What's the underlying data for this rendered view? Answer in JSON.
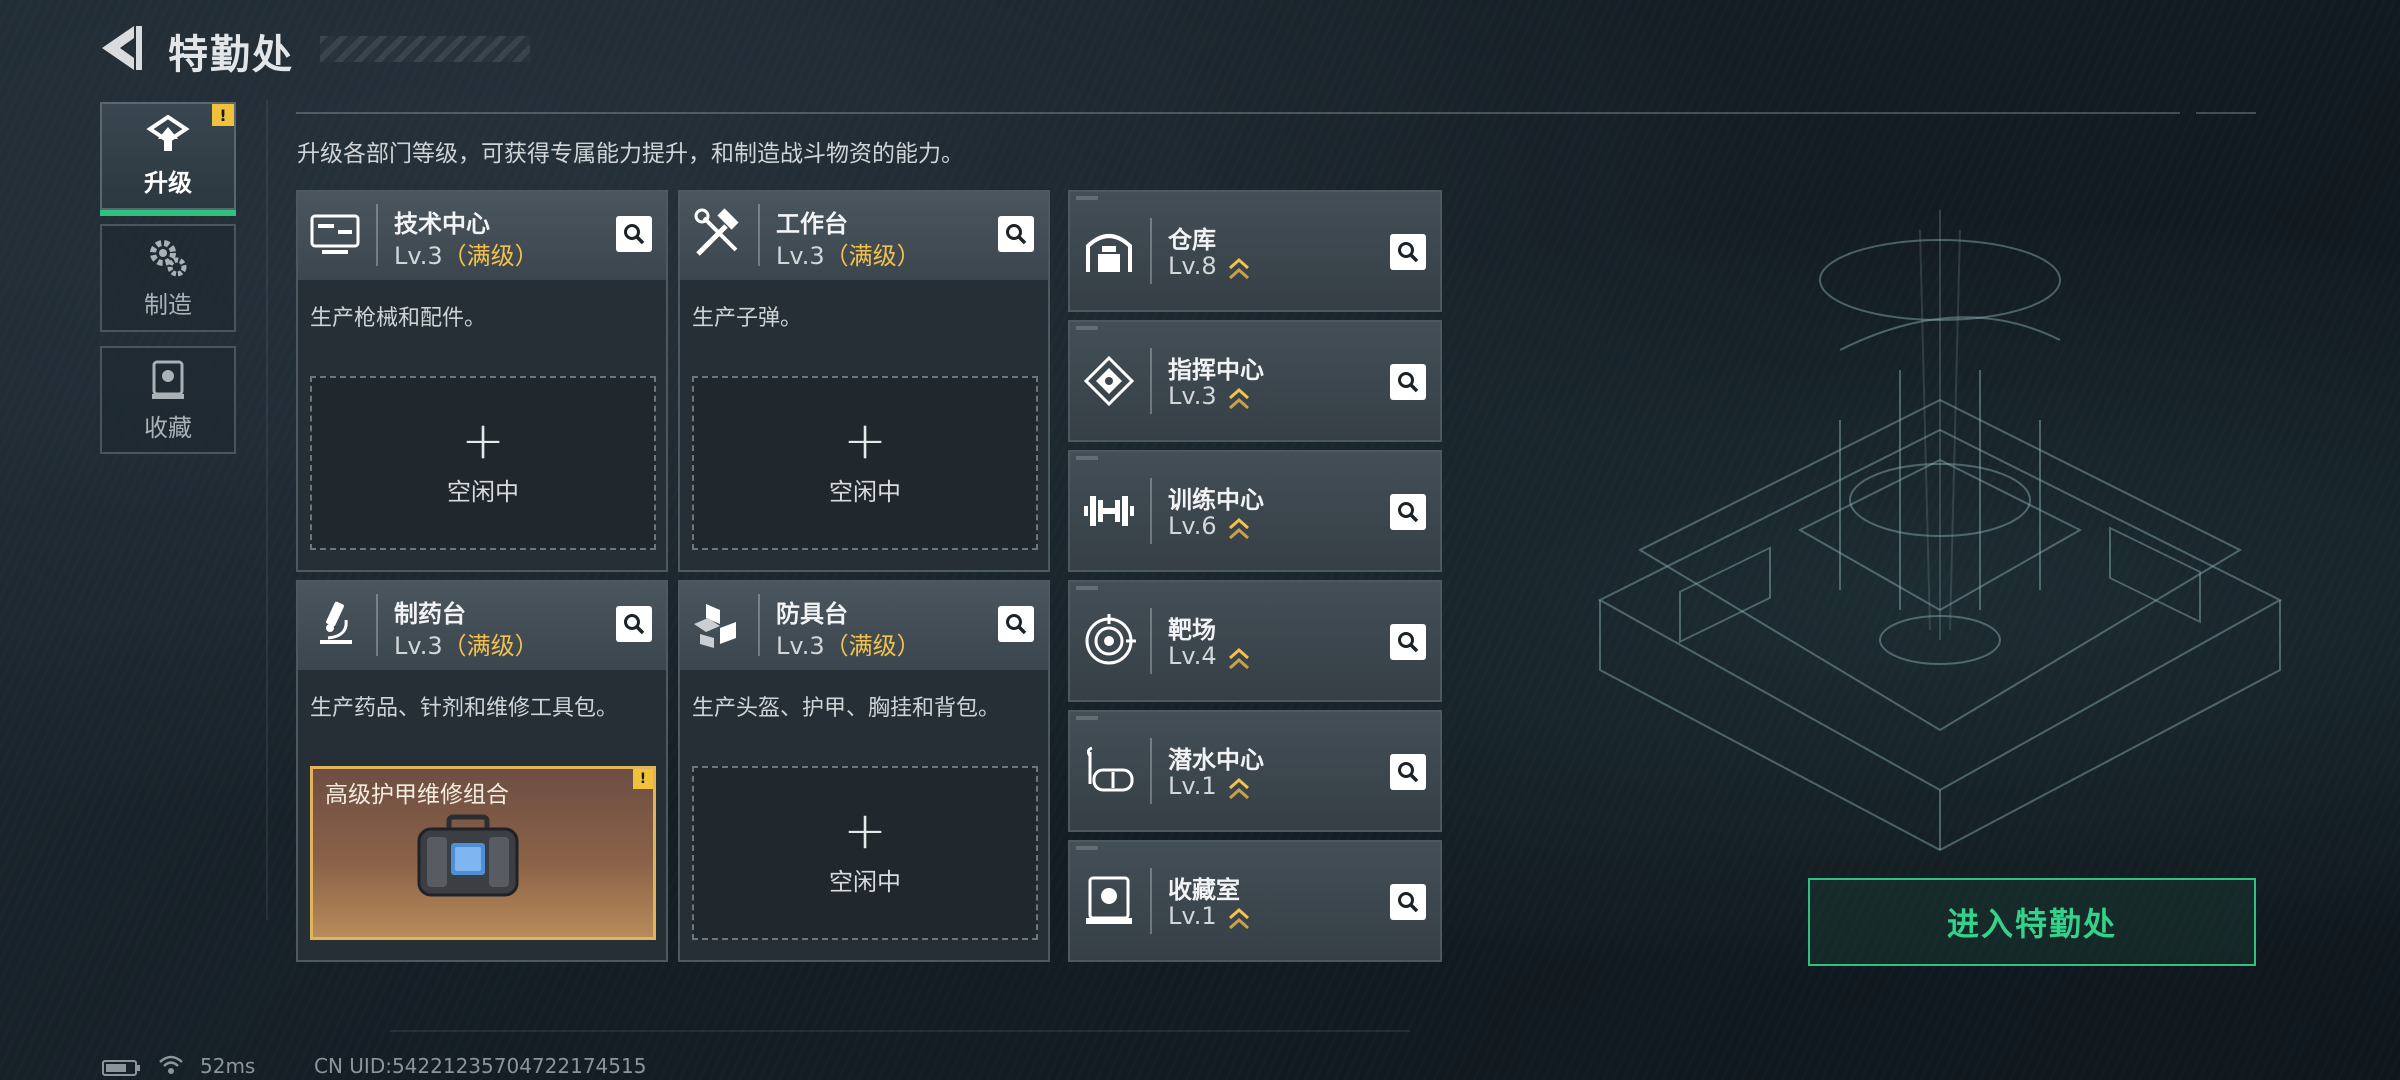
{
  "header": {
    "title": "特勤处"
  },
  "sidebar": {
    "items": [
      {
        "label": "升级",
        "icon": "upgrade-icon"
      },
      {
        "label": "制造",
        "icon": "gears-icon"
      },
      {
        "label": "收藏",
        "icon": "collection-icon"
      }
    ],
    "alert": "!"
  },
  "main": {
    "description": "升级各部门等级，可获得专属能力提升，和制造战斗物资的能力。",
    "cards": [
      {
        "name": "技术中心",
        "level": "Lv.3",
        "max": "（满级）",
        "desc": "生产枪械和配件。",
        "slot_plus": "+",
        "slot_status": "空闲中",
        "icon": "computer-icon"
      },
      {
        "name": "工作台",
        "level": "Lv.3",
        "max": "（满级）",
        "desc": "生产子弹。",
        "slot_plus": "+",
        "slot_status": "空闲中",
        "icon": "tools-icon"
      },
      {
        "name": "制药台",
        "level": "Lv.3",
        "max": "（满级）",
        "desc": "生产药品、针剂和维修工具包。",
        "item_name": "高级护甲维修组合",
        "item_alert": "!",
        "icon": "microscope-icon"
      },
      {
        "name": "防具台",
        "level": "Lv.3",
        "max": "（满级）",
        "desc": "生产头盔、护甲、胸挂和背包。",
        "slot_plus": "+",
        "slot_status": "空闲中",
        "icon": "armor-icon"
      }
    ],
    "facilities": [
      {
        "name": "仓库",
        "level": "Lv.8",
        "icon": "warehouse-icon"
      },
      {
        "name": "指挥中心",
        "level": "Lv.3",
        "icon": "command-icon"
      },
      {
        "name": "训练中心",
        "level": "Lv.6",
        "icon": "dumbbell-icon"
      },
      {
        "name": "靶场",
        "level": "Lv.4",
        "icon": "target-icon"
      },
      {
        "name": "潜水中心",
        "level": "Lv.1",
        "icon": "diving-mask-icon"
      },
      {
        "name": "收藏室",
        "level": "Lv.1",
        "icon": "collection-room-icon"
      }
    ]
  },
  "enter_button": {
    "label": "进入特勤处"
  },
  "footer": {
    "ping": "52ms",
    "uid": "CN UID:5422123570472217451​5"
  },
  "colors": {
    "accent_green": "#2ec27e",
    "max_level_gold": "#f2c14e",
    "alert_yellow": "#f0c23c"
  }
}
